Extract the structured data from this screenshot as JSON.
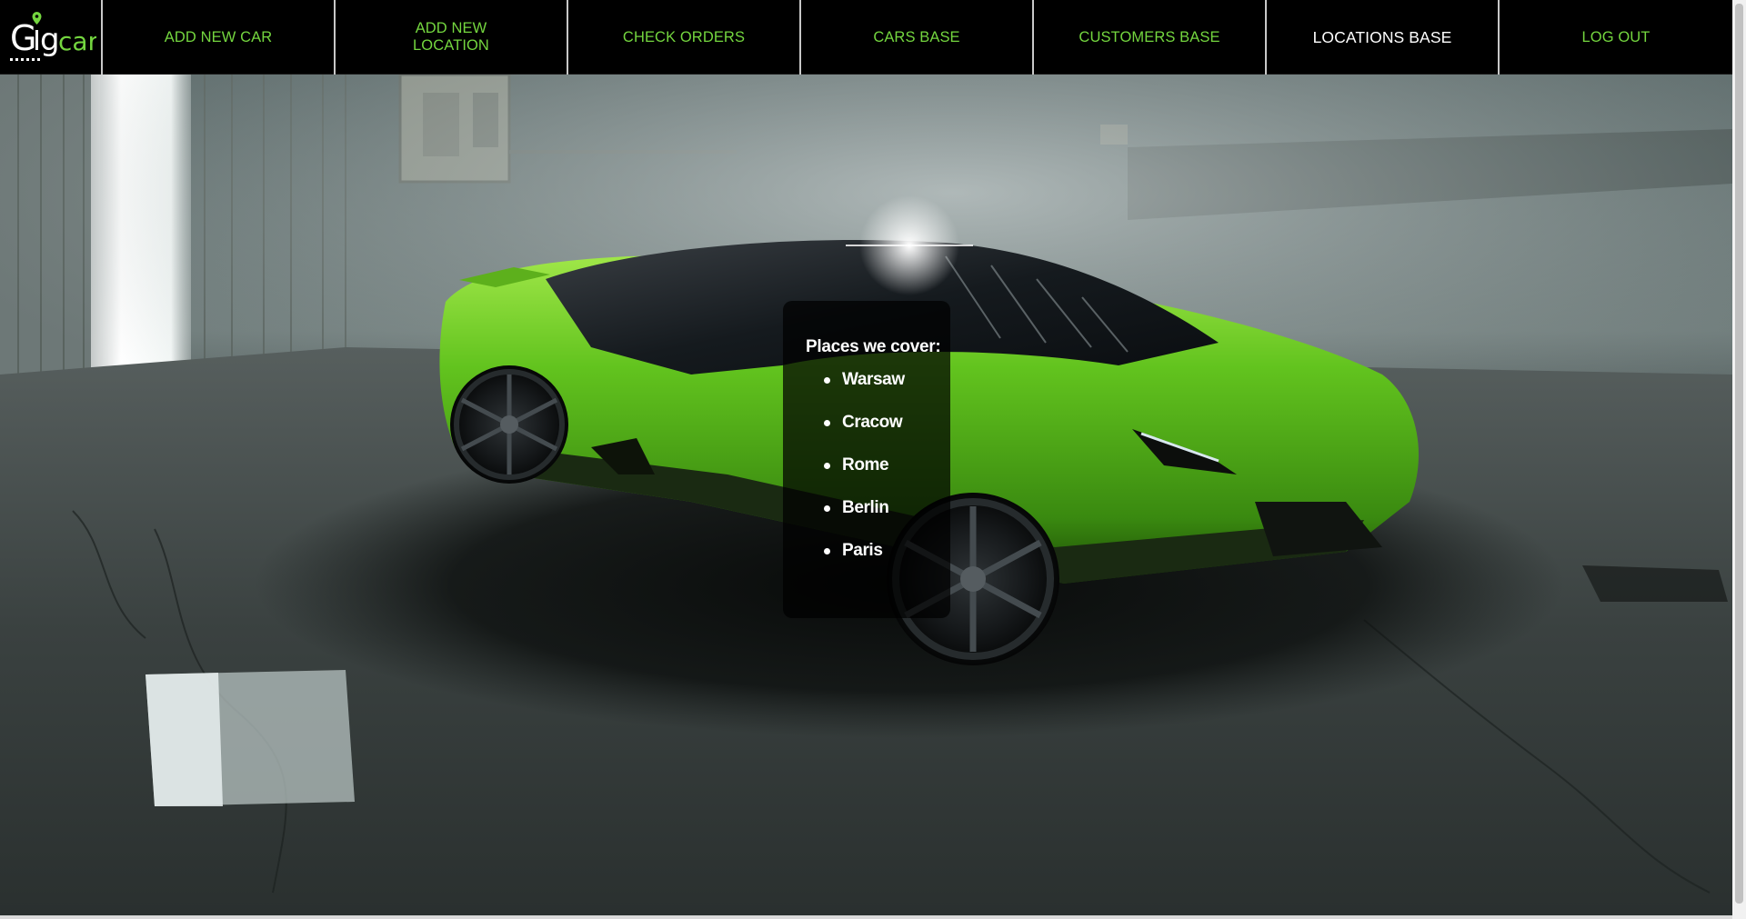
{
  "app": {
    "logo_text": "Gigcar",
    "logo_icon": "location-pin-icon",
    "accent_color": "#74d63f"
  },
  "nav": {
    "items": [
      {
        "label": "ADD NEW CAR",
        "active": false
      },
      {
        "label": "ADD NEW LOCATION",
        "active": false
      },
      {
        "label": "CHECK ORDERS",
        "active": false
      },
      {
        "label": "CARS BASE",
        "active": false
      },
      {
        "label": "CUSTOMERS BASE",
        "active": false
      },
      {
        "label": "LOCATIONS BASE",
        "active": true
      },
      {
        "label": "LOG OUT",
        "active": false
      }
    ]
  },
  "places": {
    "title": "Places we cover:",
    "list": [
      "Warsaw",
      "Cracow",
      "Rome",
      "Berlin",
      "Paris"
    ]
  }
}
